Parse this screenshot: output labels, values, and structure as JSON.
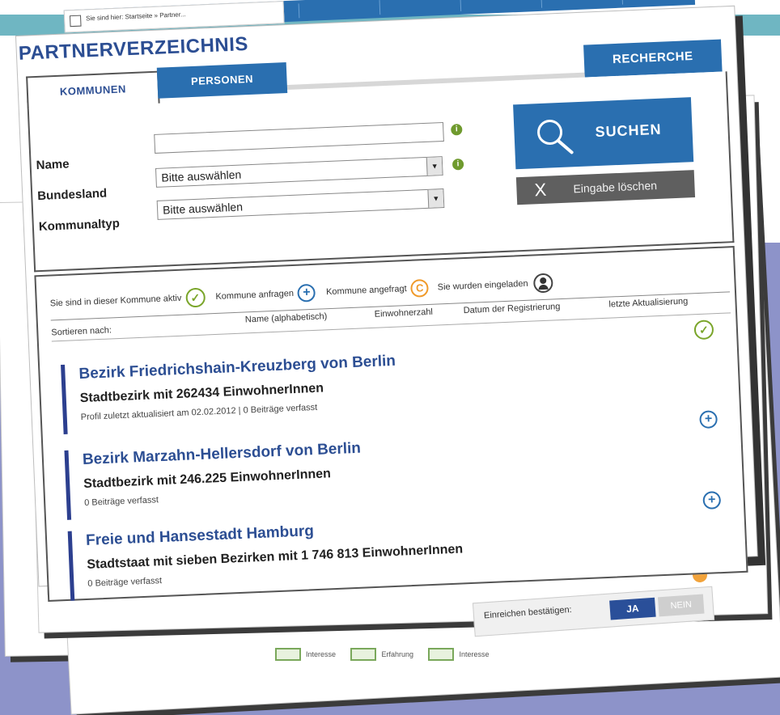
{
  "page": {
    "breadcrumb": "Sie sind hier: Startseite » Partner...",
    "title": "PARTNERVERZEICHNIS",
    "recherche_label": "RECHERCHE"
  },
  "tabs": [
    {
      "label": "KOMMUNEN",
      "active": true
    },
    {
      "label": "PERSONEN",
      "active": false
    }
  ],
  "form": {
    "name_label": "Name",
    "name_value": "",
    "bundesland_label": "Bundesland",
    "bundesland_value": "Bitte auswählen",
    "kommunaltyp_label": "Kommunaltyp",
    "kommunaltyp_value": "Bitte auswählen",
    "info_glyph": "i",
    "suchen_label": "SUCHEN",
    "clear_label": "Eingabe löschen",
    "clear_glyph": "X"
  },
  "legend": {
    "aktiv": "Sie sind in dieser Kommune aktiv",
    "anfragen": "Kommune anfragen",
    "angefragt": "Kommune angefragt",
    "eingeladen": "Sie wurden eingeladen",
    "check_glyph": "✓",
    "plus_glyph": "+",
    "c_glyph": "C"
  },
  "sort": {
    "label": "Sortieren nach:",
    "options": [
      "Name (alphabetisch)",
      "Einwohnerzahl",
      "Datum der Registrierung",
      "letzte Aktualisierung"
    ]
  },
  "results": [
    {
      "name": "Bezirk Friedrichshain-Kreuzberg von Berlin",
      "description": "Stadtbezirk mit 262434 EinwohnerInnen",
      "meta": "Profil zuletzt aktualisiert am 02.02.2012 | 0 Beiträge verfasst",
      "status_icon": "check-icon"
    },
    {
      "name": "Bezirk Marzahn-Hellersdorf von Berlin",
      "description": "Stadtbezirk mit 246.225 EinwohnerInnen",
      "meta": "0 Beiträge verfasst",
      "status_icon": "plus-icon"
    },
    {
      "name": "Freie und Hansestadt Hamburg",
      "description": "Stadtstaat mit sieben Bezirken mit 1 746 813 EinwohnerInnen",
      "meta": "0 Beiträge verfasst",
      "status_icon": "plus-icon"
    }
  ],
  "background": {
    "confirm_label": "Einreichen bestätigen:",
    "ja": "JA",
    "nein": "NEIN",
    "legend_items": [
      "Interesse",
      "Erfahrung",
      "Interesse"
    ]
  },
  "colors": {
    "primary_blue": "#2a6fb0",
    "title_blue": "#2c4e93",
    "check_green": "#7aa52a",
    "request_orange": "#f09a2a",
    "background_lavender": "#8d93c9"
  }
}
